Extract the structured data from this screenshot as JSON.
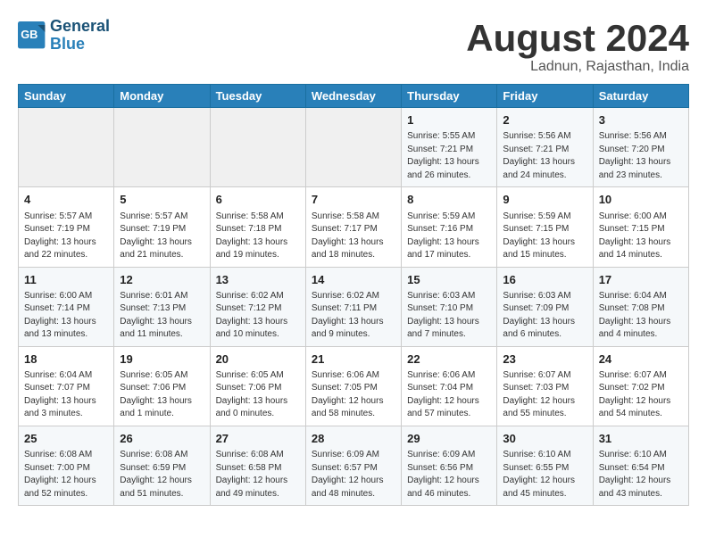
{
  "header": {
    "logo_line1": "General",
    "logo_line2": "Blue",
    "month_title": "August 2024",
    "location": "Ladnun, Rajasthan, India"
  },
  "days_of_week": [
    "Sunday",
    "Monday",
    "Tuesday",
    "Wednesday",
    "Thursday",
    "Friday",
    "Saturday"
  ],
  "weeks": [
    [
      {
        "day": "",
        "info": ""
      },
      {
        "day": "",
        "info": ""
      },
      {
        "day": "",
        "info": ""
      },
      {
        "day": "",
        "info": ""
      },
      {
        "day": "1",
        "info": "Sunrise: 5:55 AM\nSunset: 7:21 PM\nDaylight: 13 hours\nand 26 minutes."
      },
      {
        "day": "2",
        "info": "Sunrise: 5:56 AM\nSunset: 7:21 PM\nDaylight: 13 hours\nand 24 minutes."
      },
      {
        "day": "3",
        "info": "Sunrise: 5:56 AM\nSunset: 7:20 PM\nDaylight: 13 hours\nand 23 minutes."
      }
    ],
    [
      {
        "day": "4",
        "info": "Sunrise: 5:57 AM\nSunset: 7:19 PM\nDaylight: 13 hours\nand 22 minutes."
      },
      {
        "day": "5",
        "info": "Sunrise: 5:57 AM\nSunset: 7:19 PM\nDaylight: 13 hours\nand 21 minutes."
      },
      {
        "day": "6",
        "info": "Sunrise: 5:58 AM\nSunset: 7:18 PM\nDaylight: 13 hours\nand 19 minutes."
      },
      {
        "day": "7",
        "info": "Sunrise: 5:58 AM\nSunset: 7:17 PM\nDaylight: 13 hours\nand 18 minutes."
      },
      {
        "day": "8",
        "info": "Sunrise: 5:59 AM\nSunset: 7:16 PM\nDaylight: 13 hours\nand 17 minutes."
      },
      {
        "day": "9",
        "info": "Sunrise: 5:59 AM\nSunset: 7:15 PM\nDaylight: 13 hours\nand 15 minutes."
      },
      {
        "day": "10",
        "info": "Sunrise: 6:00 AM\nSunset: 7:15 PM\nDaylight: 13 hours\nand 14 minutes."
      }
    ],
    [
      {
        "day": "11",
        "info": "Sunrise: 6:00 AM\nSunset: 7:14 PM\nDaylight: 13 hours\nand 13 minutes."
      },
      {
        "day": "12",
        "info": "Sunrise: 6:01 AM\nSunset: 7:13 PM\nDaylight: 13 hours\nand 11 minutes."
      },
      {
        "day": "13",
        "info": "Sunrise: 6:02 AM\nSunset: 7:12 PM\nDaylight: 13 hours\nand 10 minutes."
      },
      {
        "day": "14",
        "info": "Sunrise: 6:02 AM\nSunset: 7:11 PM\nDaylight: 13 hours\nand 9 minutes."
      },
      {
        "day": "15",
        "info": "Sunrise: 6:03 AM\nSunset: 7:10 PM\nDaylight: 13 hours\nand 7 minutes."
      },
      {
        "day": "16",
        "info": "Sunrise: 6:03 AM\nSunset: 7:09 PM\nDaylight: 13 hours\nand 6 minutes."
      },
      {
        "day": "17",
        "info": "Sunrise: 6:04 AM\nSunset: 7:08 PM\nDaylight: 13 hours\nand 4 minutes."
      }
    ],
    [
      {
        "day": "18",
        "info": "Sunrise: 6:04 AM\nSunset: 7:07 PM\nDaylight: 13 hours\nand 3 minutes."
      },
      {
        "day": "19",
        "info": "Sunrise: 6:05 AM\nSunset: 7:06 PM\nDaylight: 13 hours\nand 1 minute."
      },
      {
        "day": "20",
        "info": "Sunrise: 6:05 AM\nSunset: 7:06 PM\nDaylight: 13 hours\nand 0 minutes."
      },
      {
        "day": "21",
        "info": "Sunrise: 6:06 AM\nSunset: 7:05 PM\nDaylight: 12 hours\nand 58 minutes."
      },
      {
        "day": "22",
        "info": "Sunrise: 6:06 AM\nSunset: 7:04 PM\nDaylight: 12 hours\nand 57 minutes."
      },
      {
        "day": "23",
        "info": "Sunrise: 6:07 AM\nSunset: 7:03 PM\nDaylight: 12 hours\nand 55 minutes."
      },
      {
        "day": "24",
        "info": "Sunrise: 6:07 AM\nSunset: 7:02 PM\nDaylight: 12 hours\nand 54 minutes."
      }
    ],
    [
      {
        "day": "25",
        "info": "Sunrise: 6:08 AM\nSunset: 7:00 PM\nDaylight: 12 hours\nand 52 minutes."
      },
      {
        "day": "26",
        "info": "Sunrise: 6:08 AM\nSunset: 6:59 PM\nDaylight: 12 hours\nand 51 minutes."
      },
      {
        "day": "27",
        "info": "Sunrise: 6:08 AM\nSunset: 6:58 PM\nDaylight: 12 hours\nand 49 minutes."
      },
      {
        "day": "28",
        "info": "Sunrise: 6:09 AM\nSunset: 6:57 PM\nDaylight: 12 hours\nand 48 minutes."
      },
      {
        "day": "29",
        "info": "Sunrise: 6:09 AM\nSunset: 6:56 PM\nDaylight: 12 hours\nand 46 minutes."
      },
      {
        "day": "30",
        "info": "Sunrise: 6:10 AM\nSunset: 6:55 PM\nDaylight: 12 hours\nand 45 minutes."
      },
      {
        "day": "31",
        "info": "Sunrise: 6:10 AM\nSunset: 6:54 PM\nDaylight: 12 hours\nand 43 minutes."
      }
    ]
  ]
}
